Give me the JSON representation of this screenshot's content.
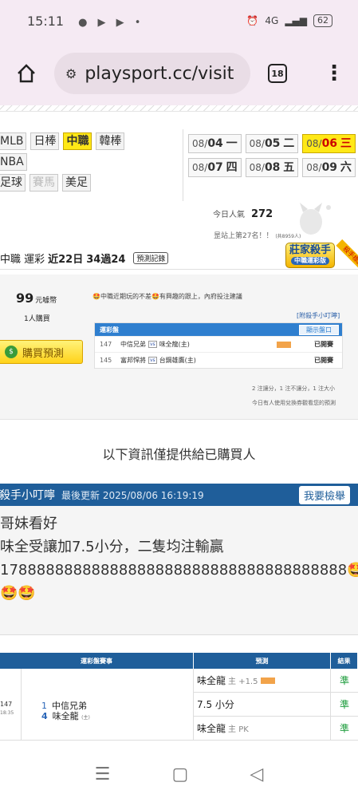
{
  "status": {
    "time": "15:11",
    "left_icons": [
      "chat-icon",
      "youtube-icon",
      "youtube-icon",
      "dot-icon"
    ],
    "net": "4G",
    "battery": "62"
  },
  "browser": {
    "url": "playsport.cc/visit",
    "tab_count": "18"
  },
  "sports": {
    "rows": [
      [
        {
          "label": "MLB",
          "state": "normal"
        },
        {
          "label": "日棒",
          "state": "normal"
        },
        {
          "label": "中職",
          "state": "active"
        },
        {
          "label": "韓棒",
          "state": "normal"
        }
      ],
      [
        {
          "label": "NBA",
          "state": "normal"
        }
      ],
      [
        {
          "label": "足球",
          "state": "normal"
        },
        {
          "label": "賽馬",
          "state": "disabled"
        },
        {
          "label": "美足",
          "state": "normal"
        }
      ]
    ]
  },
  "dates": [
    {
      "md": "08/",
      "day": "04",
      "wd": "一",
      "active": false
    },
    {
      "md": "08/",
      "day": "05",
      "wd": "二",
      "active": false
    },
    {
      "md": "08/",
      "day": "06",
      "wd": "三",
      "active": true
    },
    {
      "md": "08/",
      "day": "07",
      "wd": "四",
      "active": false
    },
    {
      "md": "08/",
      "day": "08",
      "wd": "五",
      "active": false
    },
    {
      "md": "08/",
      "day": "09",
      "wd": "六",
      "active": false
    }
  ],
  "popularity": {
    "label": "今日人氣",
    "value": "272"
  },
  "rank": {
    "text": "昰站上第27名！！",
    "small": "(共8959人)"
  },
  "badge": {
    "title": "莊家殺手",
    "sub": "中職運彩版",
    "ribbon": "殺手標語"
  },
  "info": {
    "league": "中職 運彩",
    "period": "近22日",
    "record": "34過24",
    "record_btn": "預測記錄"
  },
  "buy": {
    "price": "99",
    "price_unit": "元噱幣",
    "buyers": "1人購買",
    "button": "購買預測",
    "tip": "🤩中職近期玩的不差🤩有興趣的跟上，內府投注建議",
    "helper_link": "[附殺手小叮嚀]",
    "table_title": "運彩盤",
    "show_btn": "顯示盤口",
    "rows": [
      {
        "num": "147",
        "away": "中信兄弟",
        "vs": "vs",
        "home": "味全龍(主)",
        "status": "已開賽",
        "tag": true
      },
      {
        "num": "145",
        "away": "富邦悍將",
        "vs": "vs",
        "home": "台鋼雄鷹(主)",
        "status": "已開賽",
        "tag": false
      }
    ],
    "note1": "2 注讓分，1 注不讓分，1 注大小",
    "note2": "今日有人使用兌換券觀看您的預測"
  },
  "only_buyers": "以下資訊僅提供給已購買人",
  "helper": {
    "title": "殺手小叮嚀",
    "updated": "最後更新 2025/08/06 16:19:19",
    "report_btn": "我要檢舉",
    "lines": [
      "哥妹看好",
      "味全受讓加7.5小分，二隻均注輸贏",
      "17888888888888888888888888888888888888🤩",
      "🤩🤩"
    ]
  },
  "results": {
    "headers": [
      "運彩盤賽事",
      "預測",
      "結果"
    ],
    "game": {
      "num": "147",
      "time": "18:35",
      "s1": "1",
      "t1": "中信兄弟",
      "s2": "4",
      "t2": "味全龍",
      "home_tag": "(主)"
    },
    "preds": [
      {
        "team": "味全龍",
        "detail": "主 +1.5",
        "tag": true,
        "result": "準"
      },
      {
        "team": "7.5 小分",
        "detail": "",
        "tag": false,
        "result": "準"
      },
      {
        "team": "味全龍",
        "detail": "主 PK",
        "tag": false,
        "result": "準"
      }
    ]
  },
  "nav": [
    "recents-icon",
    "home-icon",
    "back-icon"
  ]
}
